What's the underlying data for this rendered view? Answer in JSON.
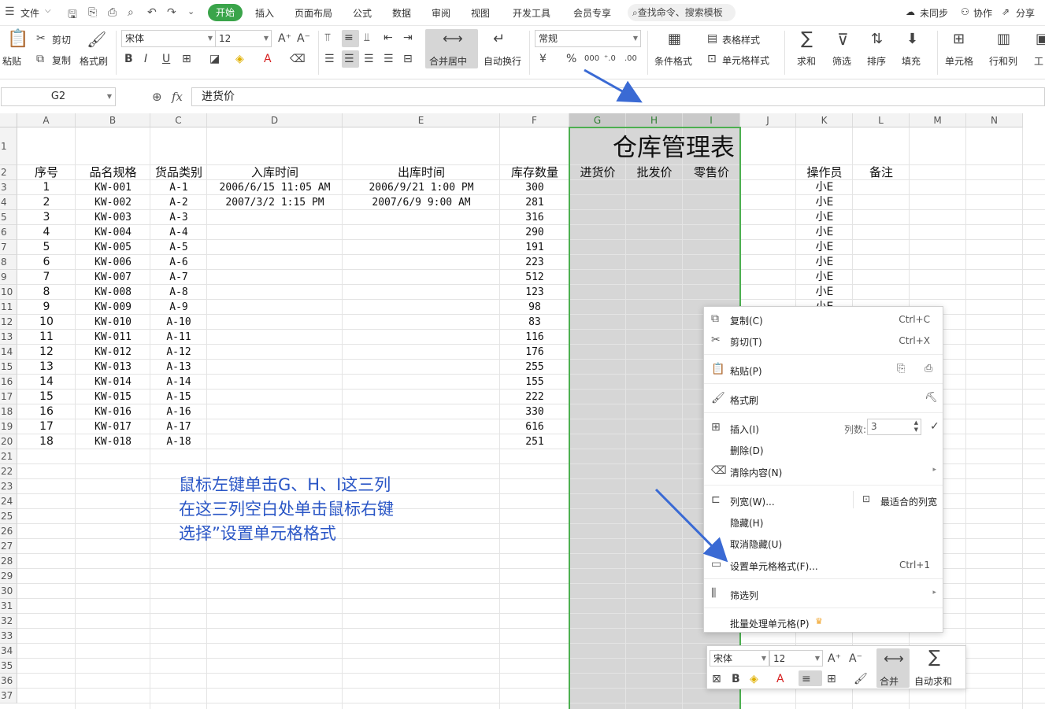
{
  "menubar": {
    "file": "文件",
    "tabs": [
      "开始",
      "插入",
      "页面布局",
      "公式",
      "数据",
      "审阅",
      "视图",
      "开发工具",
      "会员专享"
    ],
    "search": "查找命令、搜索模板",
    "unsync": "未同步",
    "collab": "协作",
    "share": "分享"
  },
  "ribbon": {
    "paste": "粘贴",
    "cut": "剪切",
    "copy": "复制",
    "format_painter": "格式刷",
    "font_name": "宋体",
    "font_size": "12",
    "merge_center": "合并居中",
    "wrap": "自动换行",
    "number_format": "常规",
    "cond_format": "条件格式",
    "table_style": "表格样式",
    "cell_style": "单元格样式",
    "sum": "求和",
    "filter": "筛选",
    "sort": "排序",
    "fill": "填充",
    "cell": "单元格",
    "rowcol": "行和列",
    "worksheet": "工"
  },
  "formula_bar": {
    "name_box": "G2",
    "fx": "fx",
    "value": "进货价"
  },
  "columns": [
    "A",
    "B",
    "C",
    "D",
    "E",
    "F",
    "G",
    "H",
    "I",
    "J",
    "K",
    "L",
    "M",
    "N"
  ],
  "sheet": {
    "title": "仓库管理表",
    "headers": [
      "序号",
      "品名规格",
      "货品类别",
      "入库时间",
      "出库时间",
      "库存数量",
      "进货价",
      "批发价",
      "零售价",
      "操作员",
      "备注"
    ],
    "rows": [
      [
        "1",
        "KW-001",
        "A-1",
        "2006/6/15 11:05 AM",
        "2006/9/21 1:00 PM",
        "300"
      ],
      [
        "2",
        "KW-002",
        "A-2",
        "2007/3/2 1:15 PM",
        "2007/6/9 9:00 AM",
        "281"
      ],
      [
        "3",
        "KW-003",
        "A-3",
        "",
        "",
        "316"
      ],
      [
        "4",
        "KW-004",
        "A-4",
        "",
        "",
        "290"
      ],
      [
        "5",
        "KW-005",
        "A-5",
        "",
        "",
        "191"
      ],
      [
        "6",
        "KW-006",
        "A-6",
        "",
        "",
        "223"
      ],
      [
        "7",
        "KW-007",
        "A-7",
        "",
        "",
        "512"
      ],
      [
        "8",
        "KW-008",
        "A-8",
        "",
        "",
        "123"
      ],
      [
        "9",
        "KW-009",
        "A-9",
        "",
        "",
        "98"
      ],
      [
        "10",
        "KW-010",
        "A-10",
        "",
        "",
        "83"
      ],
      [
        "11",
        "KW-011",
        "A-11",
        "",
        "",
        "116"
      ],
      [
        "12",
        "KW-012",
        "A-12",
        "",
        "",
        "176"
      ],
      [
        "13",
        "KW-013",
        "A-13",
        "",
        "",
        "255"
      ],
      [
        "14",
        "KW-014",
        "A-14",
        "",
        "",
        "155"
      ],
      [
        "15",
        "KW-015",
        "A-15",
        "",
        "",
        "222"
      ],
      [
        "16",
        "KW-016",
        "A-16",
        "",
        "",
        "330"
      ],
      [
        "17",
        "KW-017",
        "A-17",
        "",
        "",
        "616"
      ],
      [
        "18",
        "KW-018",
        "A-18",
        "",
        "",
        "251"
      ]
    ],
    "operator": [
      "小E",
      "小E",
      "小E",
      "小E",
      "小E",
      "小E",
      "小E",
      "小E",
      "小E"
    ]
  },
  "annotation": [
    "鼠标左键单击G、H、I这三列",
    "在这三列空白处单击鼠标右键",
    "选择”设置单元格格式"
  ],
  "context_menu": {
    "copy": "复制(C)",
    "copy_sc": "Ctrl+C",
    "cut": "剪切(T)",
    "cut_sc": "Ctrl+X",
    "paste": "粘贴(P)",
    "format_painter": "格式刷",
    "insert": "插入(I)",
    "col_count_label": "列数:",
    "col_count": "3",
    "delete": "删除(D)",
    "clear": "清除内容(N)",
    "col_width": "列宽(W)...",
    "best_fit": "最适合的列宽",
    "hide": "隐藏(H)",
    "unhide": "取消隐藏(U)",
    "format_cells": "设置单元格格式(F)...",
    "format_cells_sc": "Ctrl+1",
    "filter_col": "筛选列",
    "batch": "批量处理单元格(P)"
  },
  "mini_toolbar": {
    "font_name": "宋体",
    "font_size": "12",
    "merge": "合并",
    "autosum": "自动求和"
  },
  "colors": {
    "accent": "#3aa44a",
    "selection": "#d6d6d6",
    "selection_border": "#4caf50",
    "annotation": "#2a56c6",
    "arrow": "#3a6ad4"
  }
}
